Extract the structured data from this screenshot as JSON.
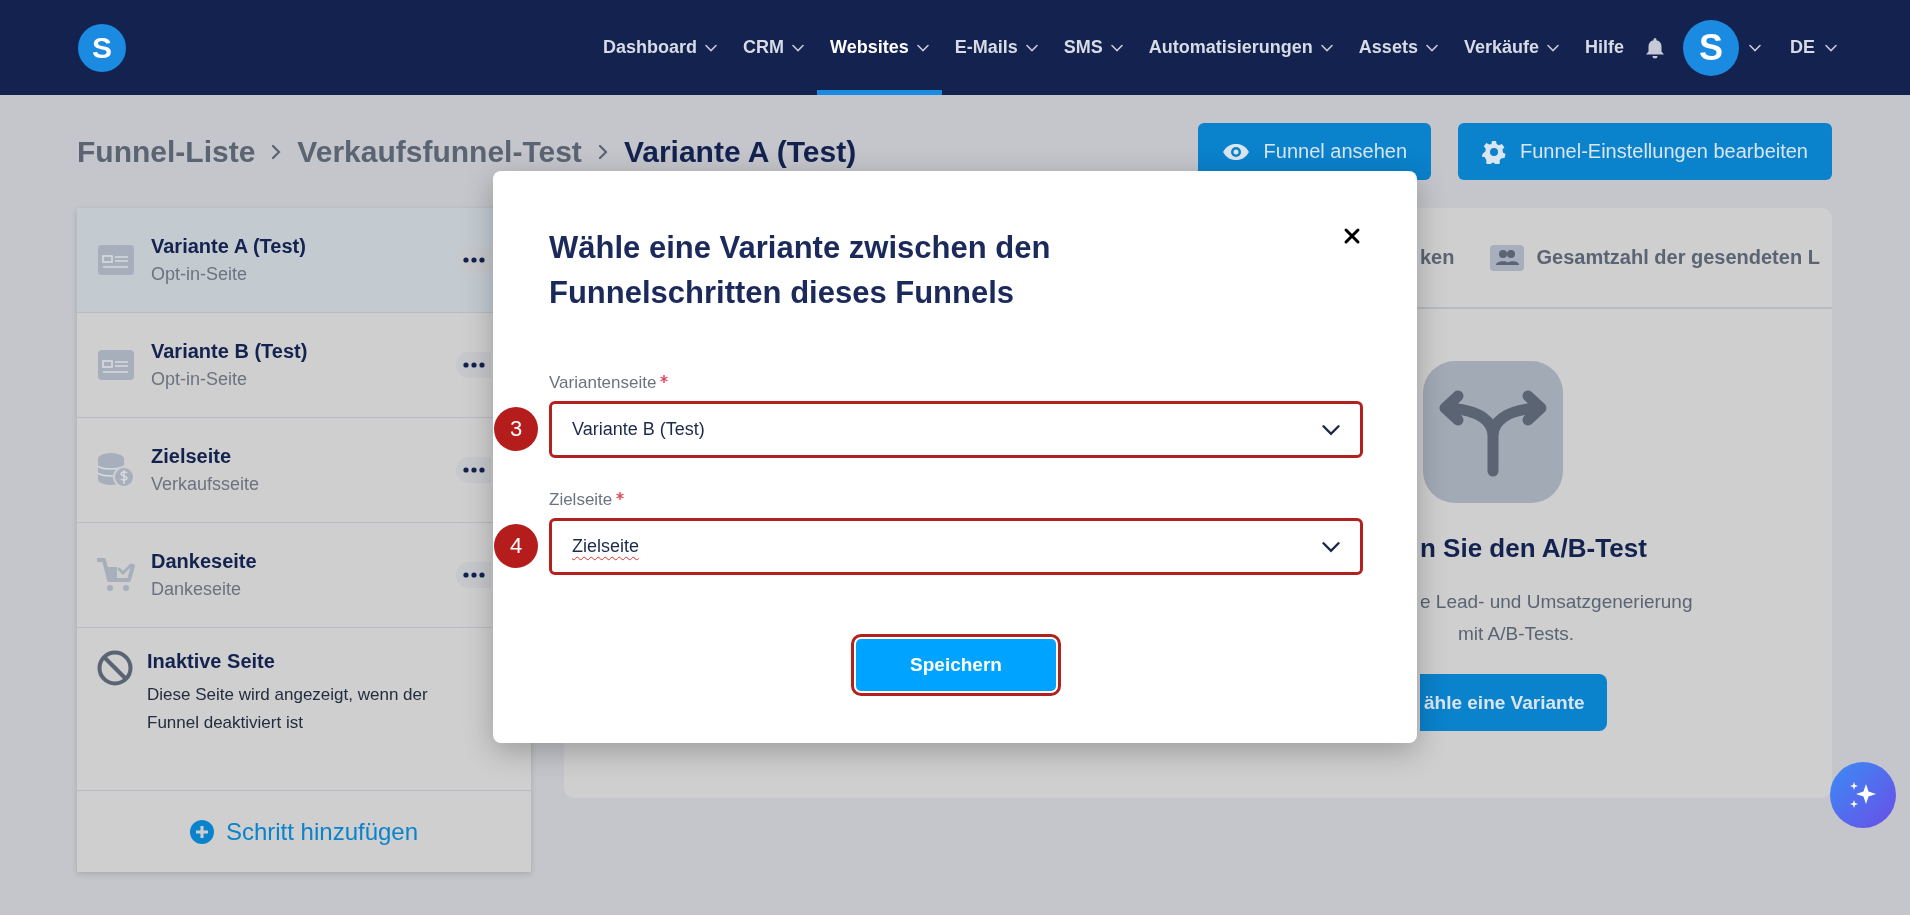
{
  "nav": {
    "logo": "S",
    "items": [
      {
        "label": "Dashboard",
        "selected": false,
        "dropdown": true
      },
      {
        "label": "CRM",
        "selected": false,
        "dropdown": true
      },
      {
        "label": "Websites",
        "selected": true,
        "dropdown": true
      },
      {
        "label": "E-Mails",
        "selected": false,
        "dropdown": true
      },
      {
        "label": "SMS",
        "selected": false,
        "dropdown": true
      },
      {
        "label": "Automatisierungen",
        "selected": false,
        "dropdown": true
      },
      {
        "label": "Assets",
        "selected": false,
        "dropdown": true
      },
      {
        "label": "Verkäufe",
        "selected": false,
        "dropdown": true
      },
      {
        "label": "Hilfe",
        "selected": false,
        "dropdown": false
      }
    ],
    "avatar": "S",
    "language": "DE"
  },
  "breadcrumb": [
    "Funnel-Liste",
    "Verkaufsfunnel-Test",
    "Variante A (Test)"
  ],
  "actions": [
    {
      "label": "Funnel ansehen",
      "kind": "eye"
    },
    {
      "label": "Funnel-Einstellungen bearbeiten",
      "kind": "gear"
    }
  ],
  "steps": [
    {
      "title": "Variante A (Test)",
      "subtitle": "Opt-in-Seite",
      "kind": "optin",
      "selected": true
    },
    {
      "title": "Variante B (Test)",
      "subtitle": "Opt-in-Seite",
      "kind": "optin",
      "selected": false
    },
    {
      "title": "Zielseite",
      "subtitle": "Verkaufsseite",
      "kind": "sales",
      "selected": false
    },
    {
      "title": "Dankeseite",
      "subtitle": "Dankeseite",
      "kind": "thankyou",
      "selected": false
    }
  ],
  "inactive_page": {
    "title": "Inaktive Seite",
    "description": "Diese Seite wird angezeigt, wenn der Funnel deaktiviert ist"
  },
  "add_step": "Schritt hinzufügen",
  "panel": {
    "tabs": [
      {
        "label": "ken",
        "kind": "text"
      },
      {
        "label": "Gesamtzahl der gesendeten L",
        "kind": "people"
      }
    ],
    "heading": "n Sie den A/B-Test",
    "description_lines": [
      "e Lead- und Umsatzgenerierung",
      "mit A/B-Tests."
    ],
    "button": "ähle eine Variante"
  },
  "modal": {
    "title": "Wähle eine Variante zwischen den Funnelschritten dieses Funnels",
    "fields": [
      {
        "label": "Variantenseite",
        "required": true,
        "value": "Variante B (Test)",
        "marker": "3",
        "highlighted": true,
        "misspelled": false
      },
      {
        "label": "Zielseite",
        "required": true,
        "value": "Zielseite",
        "marker": "4",
        "highlighted": true,
        "misspelled": true
      }
    ],
    "save": {
      "label": "Speichern",
      "highlighted": true
    }
  }
}
